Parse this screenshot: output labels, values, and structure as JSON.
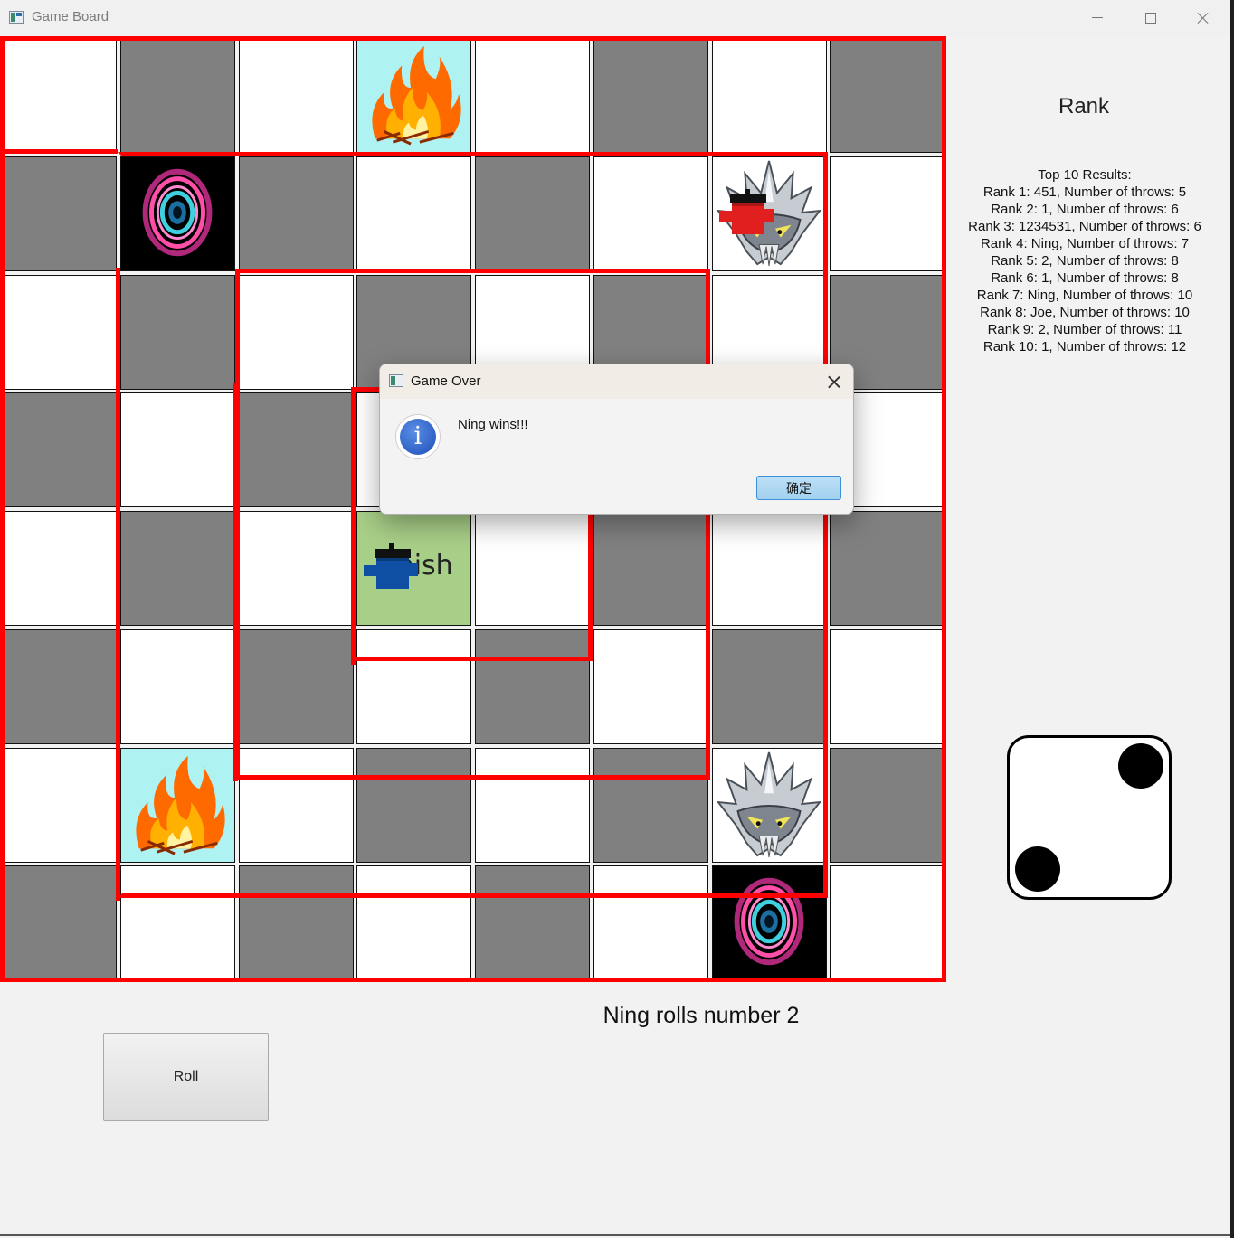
{
  "window": {
    "title": "Game Board"
  },
  "board": {
    "cols": 8,
    "rows": 8,
    "cells": [
      [
        "light",
        "dark",
        "light",
        "fire",
        "light",
        "dark",
        "light",
        "dark"
      ],
      [
        "dark",
        "portal",
        "dark",
        "light",
        "dark",
        "light",
        "monster",
        "light"
      ],
      [
        "light",
        "dark",
        "light",
        "dark",
        "light",
        "dark",
        "light",
        "dark"
      ],
      [
        "dark",
        "light",
        "dark",
        "light",
        "dark",
        "light",
        "dark",
        "light"
      ],
      [
        "light",
        "dark",
        "light",
        "finish",
        "light",
        "dark",
        "light",
        "dark"
      ],
      [
        "dark",
        "light",
        "dark",
        "light",
        "dark",
        "light",
        "dark",
        "light"
      ],
      [
        "light",
        "fire",
        "light",
        "dark",
        "light",
        "dark",
        "monster",
        "dark"
      ],
      [
        "dark",
        "light",
        "dark",
        "light",
        "dark",
        "light",
        "portal",
        "light"
      ]
    ],
    "finish_label": "Finish",
    "players": [
      {
        "name": "red-player",
        "color": "#e21f1f",
        "row": 1,
        "col": 6
      },
      {
        "name": "blue-player",
        "color": "#0e4fa3",
        "row": 4,
        "col": 3
      }
    ],
    "track_color": "#ff0000"
  },
  "rank": {
    "title": "Rank",
    "header": "Top 10 Results:",
    "entries": [
      "Rank 1: 451, Number of throws: 5",
      "Rank 2: 1, Number of throws: 6",
      "Rank 3: 1234531, Number of throws: 6",
      "Rank 4: Ning, Number of throws: 7",
      "Rank 5: 2, Number of throws: 8",
      "Rank 6: 1, Number of throws: 8",
      "Rank 7: Ning, Number of throws: 10",
      "Rank 8: Joe, Number of throws: 10",
      "Rank 9: 2, Number of throws: 11",
      "Rank 10: 1, Number of throws: 12"
    ]
  },
  "dice": {
    "value": 2
  },
  "status": {
    "text": "Ning rolls number 2"
  },
  "controls": {
    "roll_label": "Roll"
  },
  "dialog": {
    "title": "Game Over",
    "message": "Ning wins!!!",
    "ok_label": "确定",
    "icon": "info-icon"
  }
}
